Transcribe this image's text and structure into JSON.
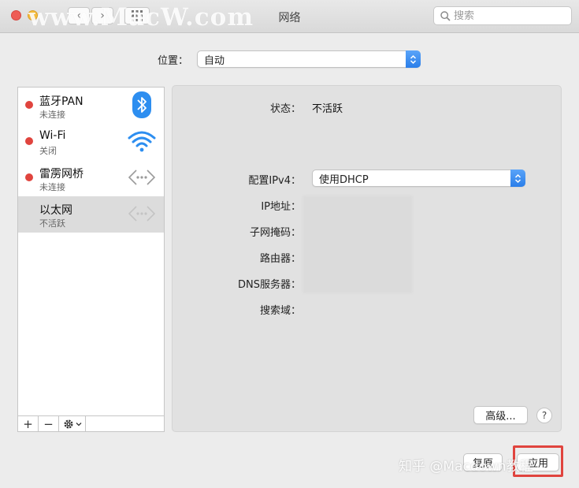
{
  "window": {
    "title": "网络"
  },
  "watermark": "www.MacW.com",
  "search": {
    "placeholder": "搜索"
  },
  "location": {
    "label": "位置：",
    "value": "自动"
  },
  "services": [
    {
      "name": "蓝牙PAN",
      "status": "未连接",
      "status_color": "#e0443e",
      "icon": "bluetooth-icon"
    },
    {
      "name": "Wi-Fi",
      "status": "关闭",
      "status_color": "#e0443e",
      "icon": "wifi-icon"
    },
    {
      "name": "雷雳网桥",
      "status": "未连接",
      "status_color": "#e0443e",
      "icon": "thunderbolt-bridge-icon"
    },
    {
      "name": "以太网",
      "status": "不活跃",
      "status_color": null,
      "icon": "ethernet-icon",
      "selected": true
    }
  ],
  "sidebar_controls": {
    "add": "+",
    "remove": "−"
  },
  "detail": {
    "status_label": "状态：",
    "status_value": "不活跃",
    "ipv4_label": "配置IPv4：",
    "ipv4_value": "使用DHCP",
    "ip_label": "IP地址：",
    "subnet_label": "子网掩码：",
    "router_label": "路由器：",
    "dns_label": "DNS服务器：",
    "search_domain_label": "搜索域：",
    "advanced_button": "高级...",
    "help_button": "?"
  },
  "footer": {
    "revert_button": "复原",
    "apply_button": "应用",
    "watermark": "知乎 @Macdown教程",
    "accent": "#e0443e"
  }
}
